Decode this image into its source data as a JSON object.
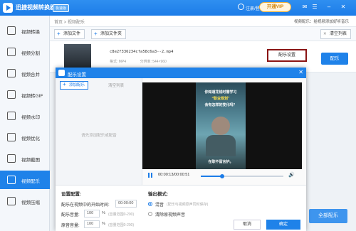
{
  "app": {
    "title": "迅捷视频转换器",
    "badge": "极速版",
    "login": "注册/登录",
    "vip": "开通VIP"
  },
  "sidebar": {
    "items": [
      {
        "label": "视频转换",
        "active": false
      },
      {
        "label": "视频分割",
        "active": false
      },
      {
        "label": "视频合并",
        "active": false
      },
      {
        "label": "视频转GIF",
        "active": false
      },
      {
        "label": "视频水印",
        "active": false
      },
      {
        "label": "视频优化",
        "active": false
      },
      {
        "label": "视频截图",
        "active": false
      },
      {
        "label": "视频配乐",
        "active": true
      },
      {
        "label": "视频压缩",
        "active": false
      }
    ]
  },
  "breadcrumb": {
    "path": "首页 > 视频配乐",
    "tip": "视频配乐：给视频添加好听音乐"
  },
  "toolbar": {
    "add_file": "添加文件",
    "add_folder": "添加文件夹",
    "clear_list": "清空列表"
  },
  "file": {
    "name": "c8e2f336234cfa58c6a3--2.mp4",
    "format_label": "格式: MP4",
    "duration_label": "时长: 00:00:51",
    "resolution_label": "分辨率: 544×960",
    "size_label": "大小: 3.42MB",
    "dub_settings": "配乐设置",
    "dub_button": "配乐"
  },
  "all_dub_button": "全部配乐",
  "dialog": {
    "title": "配乐设置",
    "add_music": "添加配乐",
    "clear_list": "清空列表",
    "empty_hint": "请先添加配乐或配音",
    "video": {
      "caption_1": "你知道花钱时需学习",
      "caption_2": "“职业规划”",
      "caption_3": "会有怎样的变化吗？",
      "subtitle": "在职不留言护。",
      "time": "00:00:13/00:00:51",
      "progress": 0.26
    },
    "settings_title": "设置配置:",
    "start_time_label": "配乐在视频中的开始时间:",
    "start_time_value": "00:00:00",
    "volume_label": "配乐音量:",
    "volume_value": "100",
    "volume_unit": "%",
    "volume_hint": "(音量范围0-200)",
    "orig_volume_label": "原音音量:",
    "orig_volume_value": "100",
    "orig_volume_unit": "%",
    "orig_volume_hint": "(音量范围0-200)",
    "output_title": "输出模式:",
    "option_mix": "混音",
    "option_mix_note": "(配乐与视频原声同时保存)",
    "option_replace": "清除原视频声音",
    "cancel": "取消",
    "confirm": "确定"
  }
}
